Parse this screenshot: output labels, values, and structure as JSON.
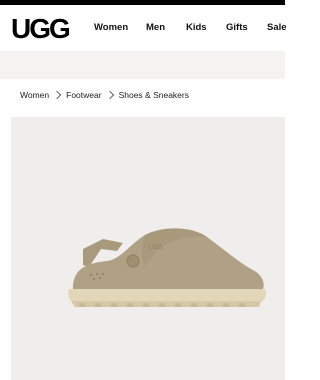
{
  "brand": {
    "logo_text": "UGG"
  },
  "nav": {
    "items": [
      "Women",
      "Men",
      "Kids",
      "Gifts",
      "Sale"
    ]
  },
  "breadcrumb": [
    "Women",
    "Footwear",
    "Shoes & Sneakers"
  ],
  "product": {
    "image_icon": "clog-shoe-illustration"
  },
  "colors": {
    "topbar": "#000000",
    "promo_bg": "#f4f3f1",
    "stage_bg": "#efeeec",
    "shoe": "#b0a184",
    "sole": "#e2d6b8"
  }
}
